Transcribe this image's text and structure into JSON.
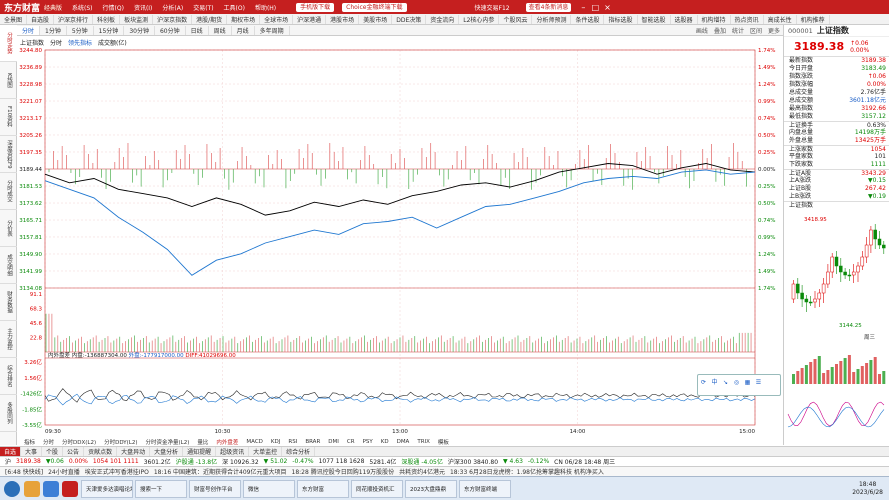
{
  "titlebar": {
    "logo": "东方财富",
    "edition": "经典版",
    "menus": [
      "系统(S)",
      "行情(Q)",
      "资讯(I)",
      "分析(A)",
      "交易(T)",
      "工具(O)",
      "帮助(H)"
    ],
    "trade_button": "手机版下载",
    "choice_button": "Choice金融终端下载",
    "quick_trade": "快速交易F12",
    "message_button": "查看4条新消息"
  },
  "navbar": {
    "items": [
      "全景图",
      "自选股",
      "沪深京排行",
      "科创板",
      "板块监测",
      "沪深京指数",
      "港股/期货",
      "期权市场",
      "全球市场",
      "沪深港通",
      "港股市场",
      "美股市场",
      "DDE决策",
      "资金流向",
      "L2核心内参",
      "个股风云",
      "分析师预测",
      "条件选股",
      "指标选股",
      "智能选股",
      "选股器",
      "机构增持",
      "热点资讯",
      "高成长性",
      "机构推荐"
    ]
  },
  "lefttabs": [
    "分时走势",
    "K线图",
    "F10资料",
    "深度资料F9",
    "分时成交",
    "分价表",
    "成交明细",
    "财务数据",
    "主力监控",
    "综合排名",
    "多股同列"
  ],
  "periodbar": {
    "tabs": [
      "分时",
      "1分钟",
      "5分钟",
      "15分钟",
      "30分钟",
      "60分钟",
      "日线",
      "周线",
      "月线",
      "多年周期"
    ],
    "tools": [
      "画线",
      "叠加",
      "统计",
      "区间",
      "更多"
    ]
  },
  "chart_head": {
    "name": "上证指数",
    "mode": "分时",
    "lead_label": "领先指标",
    "volume_label": "成交额(亿)"
  },
  "chart_data": {
    "type": "line",
    "title": "上证指数 分时",
    "preclose": 3189.44,
    "y_ticks_price": [
      3244.8,
      3236.89,
      3228.98,
      3221.07,
      3213.17,
      3205.26,
      3197.35,
      3189.44,
      3181.53,
      3173.62,
      3165.71,
      3157.81,
      3149.9,
      3141.99,
      3134.08
    ],
    "y_ticks_pct": [
      "1.74%",
      "1.49%",
      "1.24%",
      "0.99%",
      "0.74%",
      "0.50%",
      "0.25%",
      "0.00%",
      "0.25%",
      "0.50%",
      "0.74%",
      "0.99%",
      "1.24%",
      "1.49%",
      "1.74%"
    ],
    "x_ticks": [
      "09:30",
      "10:30",
      "13:00",
      "14:00",
      "15:00"
    ],
    "series": [
      {
        "name": "上证指数",
        "color": "#000000",
        "values": [
          3187,
          3183,
          3185,
          3180,
          3178,
          3176,
          3172,
          3176,
          3173,
          3168,
          3170,
          3174,
          3172,
          3175,
          3173,
          3177,
          3179,
          3182,
          3183,
          3181,
          3184,
          3188,
          3190,
          3192,
          3191,
          3187,
          3190,
          3192,
          3189,
          3188
        ]
      },
      {
        "name": "领先指标",
        "color": "#1f77d0",
        "values": [
          3184,
          3180,
          3176,
          3167,
          3160,
          3152,
          3140,
          3147,
          3150,
          3155,
          3158,
          3161,
          3159,
          3164,
          3165,
          3167,
          3162,
          3167,
          3172,
          3173,
          3176,
          3179,
          3183,
          3185,
          3186,
          3185,
          3188,
          3189,
          3187,
          3188
        ]
      }
    ],
    "volume": {
      "label": "成交额(亿)",
      "ticks": [
        91.1,
        68.3,
        45.6,
        22.8
      ]
    },
    "flow": {
      "ticks": [
        "3.26亿",
        "1.56亿",
        "-1426亿",
        "-1.85亿",
        "-3.55亿"
      ],
      "legend_in": "内外盘差",
      "in_value": "内盘:-136887304.00",
      "out_value": "外盘:-177917000.00",
      "diff_value": "DIFF:41029696.00"
    },
    "grid": true
  },
  "right_panel": {
    "code": "000001",
    "name": "上证指数",
    "price": "3189.38",
    "change": "↑0.06",
    "change_pct": "0.00%",
    "rows": [
      {
        "label": "最新指数",
        "value": "3189.38",
        "cls": ""
      },
      {
        "label": "今日开盘",
        "value": "3183.49",
        "cls": "green"
      },
      {
        "label": "指数涨跌",
        "value": "↑0.06",
        "cls": ""
      },
      {
        "label": "指数涨幅",
        "value": "0.00%",
        "cls": ""
      },
      {
        "label": "总成交量",
        "value": "2.76亿手",
        "cls": "black"
      },
      {
        "label": "总成交额",
        "value": "3601.18亿元",
        "cls": "blue"
      },
      {
        "label": "最高指数",
        "value": "3192.66",
        "cls": ""
      },
      {
        "label": "最低指数",
        "value": "3157.12",
        "cls": "green"
      },
      {
        "label": "上证换手",
        "value": "0.63%",
        "cls": "black"
      },
      {
        "label": "内盘总量",
        "value": "14198万手",
        "cls": "green"
      },
      {
        "label": "外盘总量",
        "value": "13425万手",
        "cls": ""
      },
      {
        "label": "上涨家数",
        "value": "1054",
        "cls": ""
      },
      {
        "label": "平盘家数",
        "value": "101",
        "cls": "black"
      },
      {
        "label": "下跌家数",
        "value": "1111",
        "cls": "green"
      },
      {
        "label": "上证A股",
        "value": "3343.29",
        "cls": ""
      },
      {
        "label": "上A涨跌",
        "value": "▼0.15",
        "cls": "green"
      },
      {
        "label": "上证B股",
        "value": "267.42",
        "cls": ""
      },
      {
        "label": "上B涨跌",
        "value": "▼0.19",
        "cls": "green"
      }
    ],
    "mini_chart_label": "上证指数",
    "mini_high": "3418.95",
    "mini_low": "3144.25",
    "mini_date": "周三"
  },
  "indicator_tabs": [
    "指标",
    "分时",
    "分时DDX(L2)",
    "分时DDY(L2)",
    "分时资金净量(L2)",
    "量比",
    "内外盘差",
    "MACD",
    "KDJ",
    "RSI",
    "BRAR",
    "DMI",
    "CR",
    "PSY",
    "KD",
    "DMA",
    "TRIX",
    "模板"
  ],
  "bottom_tabs": [
    "自选",
    "大事",
    "个股",
    "公告",
    "贡献点数",
    "大盘异动",
    "大盘分析",
    "通知提醒",
    "超级资讯",
    "大单监控",
    "综合分析"
  ],
  "ticker": [
    {
      "text": "沪",
      "cls": ""
    },
    {
      "text": "3189.38",
      "cls": "red"
    },
    {
      "text": "▼0.06",
      "cls": "green"
    },
    {
      "text": "0.00%",
      "cls": "red"
    },
    {
      "text": "1054 101 1111",
      "cls": "red"
    },
    {
      "text": "3601.2亿",
      "cls": ""
    },
    {
      "text": "沪股通 -13.8亿",
      "cls": "green"
    },
    {
      "text": "深 10926.32",
      "cls": ""
    },
    {
      "text": "▼ 51.02",
      "cls": "green"
    },
    {
      "text": "-0.47%",
      "cls": "green"
    },
    {
      "text": "1077 118 1628",
      "cls": ""
    },
    {
      "text": "5281.4亿",
      "cls": ""
    },
    {
      "text": "深股通 -4.05亿",
      "cls": "green"
    },
    {
      "text": "沪深300 3840.80",
      "cls": ""
    },
    {
      "text": "▼ 4.63",
      "cls": "green"
    },
    {
      "text": "-0.12%",
      "cls": "green"
    },
    {
      "text": "CN 06/28 18:48 周三",
      "cls": ""
    }
  ],
  "statusbar": {
    "items": [
      "[6:48 快快线]",
      "24小时直播",
      "埃安正式冲写香港挂IPO",
      "18:16 中国建筑：近期获得合计409亿元重大项目",
      "18:28 腾讯控股今日回购119万股股份",
      "共耗资约4亿港元",
      "18:33 6月28日龙虎榜：1.98亿抢筹掌趣科技 机构净买入"
    ]
  },
  "taskbar": {
    "tasks": [
      "天津爱多达演唱论坛",
      "搜索一下",
      "财富号创作平台",
      "微信",
      "东方财富",
      "同花顺投资机汇",
      "2023大盘鼎鼎",
      "东方财富终端"
    ],
    "clock_time": "18:48",
    "clock_date": "2023/6/28"
  }
}
